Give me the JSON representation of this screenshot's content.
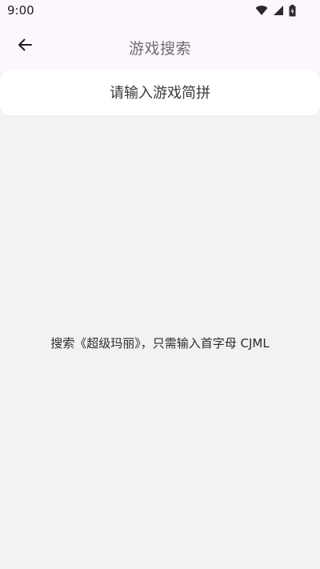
{
  "status_bar": {
    "time": "9:00",
    "icons": [
      "wifi-icon",
      "signal-icon",
      "battery-icon"
    ]
  },
  "app_bar": {
    "back_icon": "arrow-left-icon",
    "title": "游戏搜索"
  },
  "search": {
    "placeholder": "请输入游戏简拼",
    "value": ""
  },
  "hint": {
    "text": "搜索《超级玛丽》，只需输入首字母 CJML"
  },
  "colors": {
    "background": "#f1f2f4",
    "app_bar": "#fdf7fd",
    "card": "#ffffff",
    "title": "#6d6d6d"
  }
}
